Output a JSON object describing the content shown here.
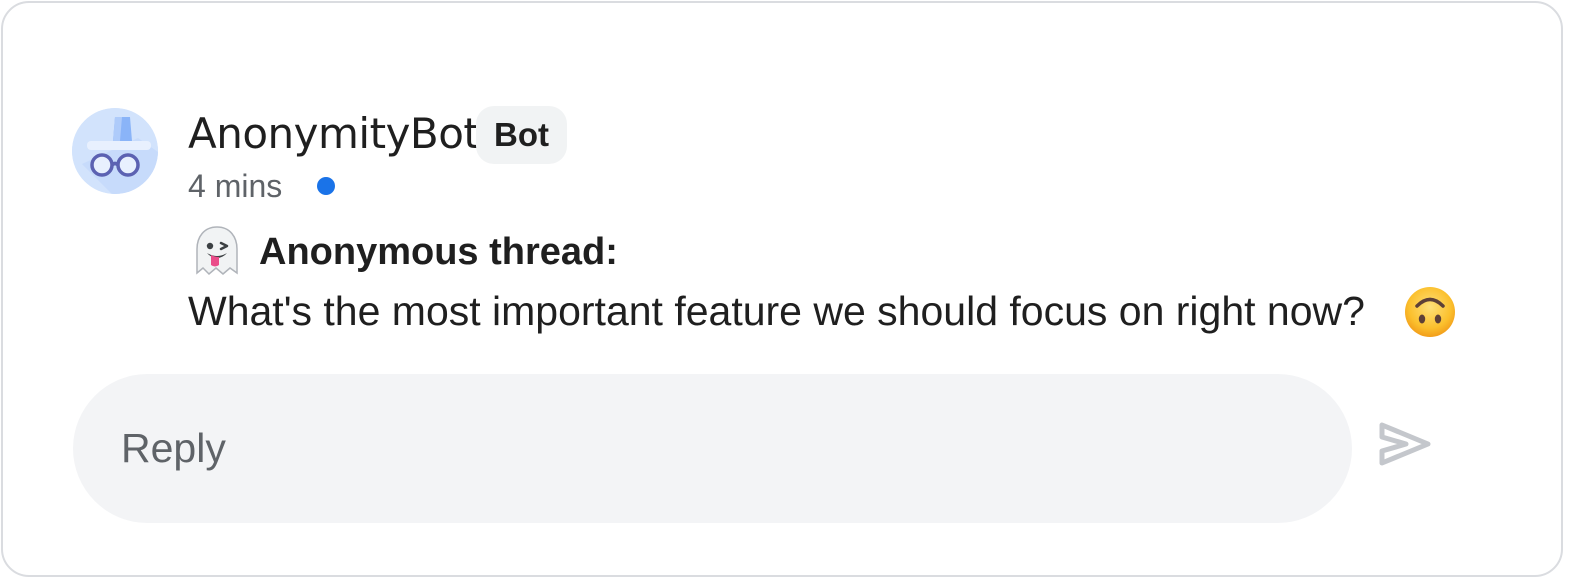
{
  "message": {
    "sender": "AnonymityBot",
    "badge": "Bot",
    "timestamp": "4 mins",
    "unread": true,
    "title_emoji_icon": "ghost-emoji-icon",
    "title": "Anonymous thread:",
    "body": "What's the most important feature we should focus on right now?",
    "body_emoji_icon": "upside-down-face-emoji-icon"
  },
  "reply": {
    "placeholder": "Reply",
    "value": "",
    "send_icon": "send-icon"
  },
  "colors": {
    "unread_dot": "#1a73e8",
    "avatar_bg": "#d2e3fc",
    "reply_bg": "#f3f4f6",
    "send_icon": "#c4c7cc",
    "border": "#dadce0"
  }
}
